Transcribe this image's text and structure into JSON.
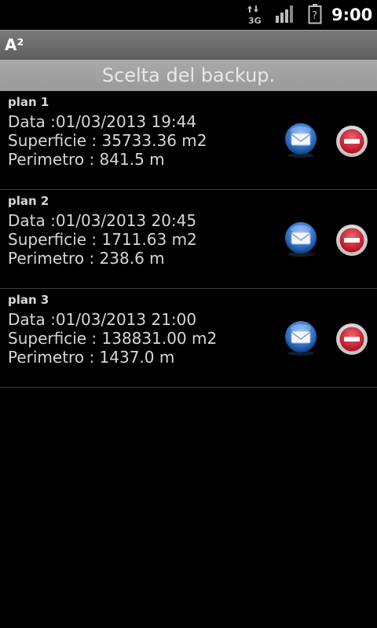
{
  "status_bar": {
    "network_label": "3G",
    "time": "9:00",
    "icons": [
      "data-arrows-icon",
      "signal-icon",
      "battery-unknown-icon"
    ]
  },
  "app": {
    "title": "A²"
  },
  "header": {
    "subtitle": "Scelta del backup."
  },
  "backups": [
    {
      "name": "plan 1",
      "date": "Data :01/03/2013 19:44",
      "area": "Superficie : 35733.36 m2",
      "perimeter": "Perimetro : 841.5 m"
    },
    {
      "name": "plan 2",
      "date": "Data :01/03/2013 20:45",
      "area": "Superficie : 1711.63 m2",
      "perimeter": "Perimetro : 238.6 m"
    },
    {
      "name": "plan 3",
      "date": "Data :01/03/2013 21:00",
      "area": "Superficie : 138831.00 m2",
      "perimeter": "Perimetro : 1437.0 m"
    }
  ],
  "colors": {
    "background": "#000000",
    "text": "#d6d6d6",
    "title_bar": "#6c6c6c",
    "subtitle_bar": "#a3a3a3",
    "mail_blue": "#2a6bc0",
    "delete_red": "#c8202a"
  }
}
